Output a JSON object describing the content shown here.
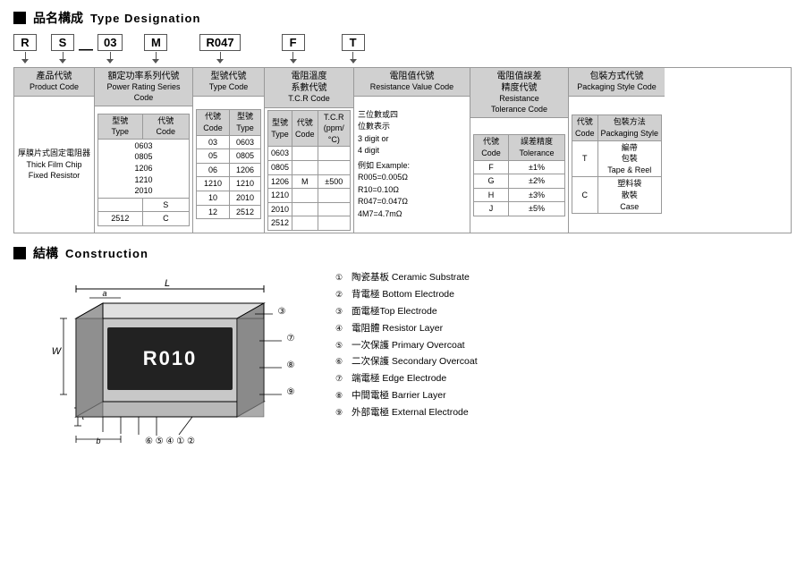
{
  "section1": {
    "title_zh": "品名構成",
    "title_en": "Type Designation"
  },
  "section2": {
    "title_zh": "結構",
    "title_en": "Construction"
  },
  "topCodes": [
    "R",
    "S",
    "03",
    "M",
    "R047",
    "F",
    "T"
  ],
  "columns": {
    "product": {
      "header_zh": "產品代號",
      "header_en": "Product Code",
      "content_zh": "厚膜片式固定電阻器",
      "content_en": "Thick Film Chip Fixed Resistor"
    },
    "power": {
      "header_zh": "額定功率系列代號",
      "header_en": "Power Rating Series Code",
      "sub_type": "型號 Type",
      "sub_code": "代號 Code",
      "rows": [
        [
          "0603",
          ""
        ],
        [
          "0805",
          ""
        ],
        [
          "1206",
          "S"
        ],
        [
          "1210",
          ""
        ],
        [
          "2010",
          ""
        ],
        [
          "2512",
          "C"
        ]
      ]
    },
    "typeCode": {
      "header_zh": "型號代號",
      "header_en": "Type Code",
      "sub_code": "代號 Code",
      "sub_type": "型號 Type",
      "rows": [
        [
          "03",
          "0603"
        ],
        [
          "05",
          "0805"
        ],
        [
          "06",
          "1206"
        ],
        [
          "1210",
          "1210"
        ],
        [
          "10",
          "2010"
        ],
        [
          "12",
          "2512"
        ]
      ]
    },
    "tcr": {
      "header_zh1": "電阻溫度",
      "header_zh2": "系數代號",
      "header_en": "T.C.R Code",
      "sub_type": "型號 Type",
      "sub_code": "代號 Code",
      "sub_tcr": "T.C.R (ppm/°C)",
      "rows": [
        [
          "0603",
          "",
          ""
        ],
        [
          "0805",
          "",
          ""
        ],
        [
          "1206",
          "M",
          "±500"
        ],
        [
          "1210",
          "",
          ""
        ],
        [
          "2010",
          "",
          ""
        ],
        [
          "2512",
          "",
          ""
        ]
      ]
    },
    "resistValue": {
      "header_zh": "電阻值代號",
      "header_en": "Resistance Value Code",
      "desc1": "三位數或四位數表示",
      "desc1_en": "3 digit or 4 digit",
      "example_label": "例如 Example:",
      "examples": [
        "R005=0.005Ω",
        "R10=0.10Ω",
        "R047=0.047Ω",
        "4M7=4.7mΩ"
      ]
    },
    "tolerance": {
      "header_zh1": "電阻值誤差",
      "header_zh2": "精度代號",
      "header_en1": "Resistance",
      "header_en2": "Tolerance Code",
      "sub_code": "代號 Code",
      "sub_tol": "誤差精度 Tolerance",
      "rows": [
        [
          "F",
          "±1%"
        ],
        [
          "G",
          "±2%"
        ],
        [
          "H",
          "±3%"
        ],
        [
          "J",
          "±5%"
        ]
      ]
    },
    "packaging": {
      "header_zh": "包裝方式代號",
      "header_en": "Packaging Style Code",
      "sub_code": "代號 Code",
      "sub_style": "包裝方法 Packaging Style",
      "rows": [
        [
          "T",
          "編帶包裝 Tape & Reel"
        ],
        [
          "C",
          "塑料袋散裝 Case"
        ]
      ]
    }
  },
  "construction": {
    "items": [
      {
        "num": "①",
        "zh": "陶瓷基板",
        "en": "Ceramic Substrate"
      },
      {
        "num": "②",
        "zh": "背電極",
        "en": "Bottom Electrode"
      },
      {
        "num": "③",
        "zh": "面電極",
        "en": "Top Electrode"
      },
      {
        "num": "④",
        "zh": "電阻體",
        "en": "Resistor Layer"
      },
      {
        "num": "⑤",
        "zh": "一次保護",
        "en": "Primary Overcoat"
      },
      {
        "num": "⑥",
        "zh": "二次保護",
        "en": "Secondary Overcoat"
      },
      {
        "num": "⑦",
        "zh": "端電極",
        "en": "Edge Electrode"
      },
      {
        "num": "⑧",
        "zh": "中間電極",
        "en": "Barrier Layer"
      },
      {
        "num": "⑨",
        "zh": "外部電極",
        "en": "External Electrode"
      }
    ]
  }
}
